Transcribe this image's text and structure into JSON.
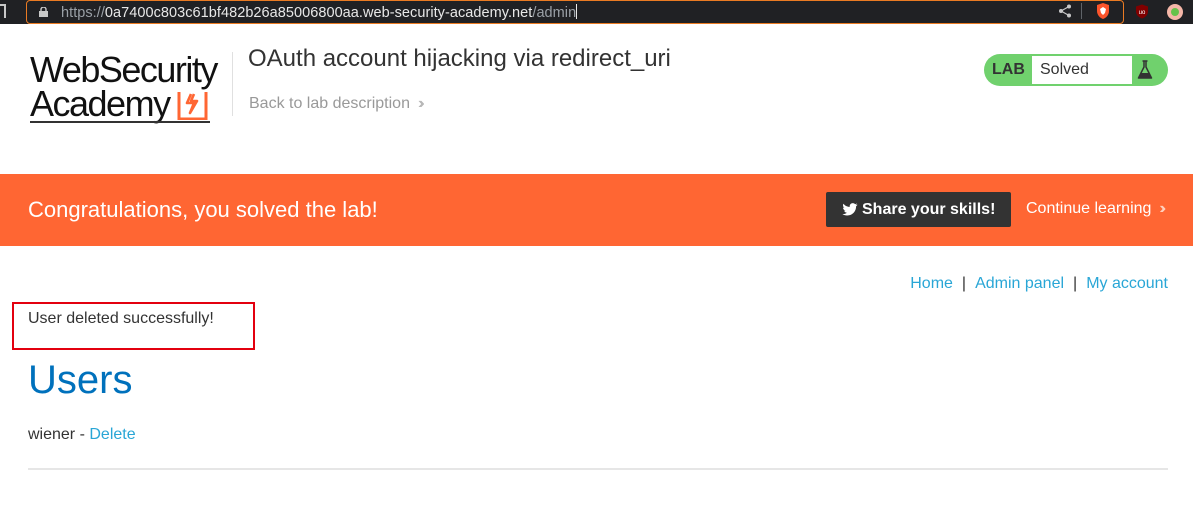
{
  "browser": {
    "url_scheme": "https://",
    "url_host": "0a7400c803c61bf482b26a85006800aa.web-security-academy.net",
    "url_path": "/admin",
    "icons": [
      "bookmark-icon",
      "lock-icon",
      "share-icon",
      "brave-shields-icon",
      "ublock-icon",
      "extension-icon"
    ]
  },
  "header": {
    "logo_line1": "WebSecurity",
    "logo_line2": "Academy",
    "lab_title": "OAuth account hijacking via redirect_uri",
    "back_link": "Back to lab description",
    "lab_badge_label": "LAB",
    "lab_status": "Solved"
  },
  "banner": {
    "message": "Congratulations, you solved the lab!",
    "share_label": "Share your skills!",
    "continue_label": "Continue learning"
  },
  "nav": {
    "items": [
      "Home",
      "Admin panel",
      "My account"
    ],
    "separator": "|"
  },
  "content": {
    "notice": "User deleted successfully!",
    "heading": "Users",
    "users": [
      {
        "name": "wiener",
        "separator": "-",
        "action": "Delete"
      }
    ]
  },
  "colors": {
    "brand_orange": "#ff6633",
    "link_blue": "#29a6d6",
    "heading_blue": "#0071bc",
    "solved_green": "#70d16d",
    "highlight_red": "#e3000f"
  }
}
